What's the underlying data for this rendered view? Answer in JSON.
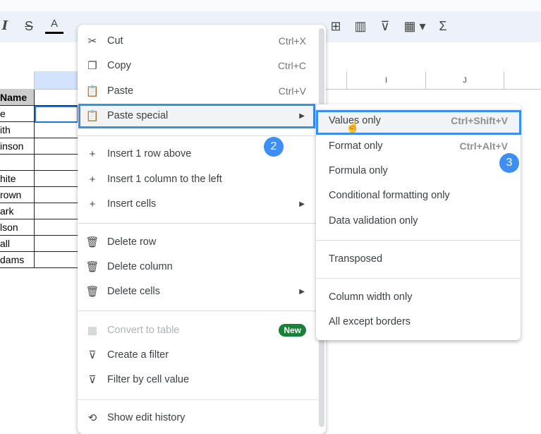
{
  "toolbar": {
    "icons": [
      "italic-icon",
      "strikethrough-icon",
      "text-color-icon",
      "insert-comment-icon",
      "insert-chart-icon",
      "filter-icon",
      "table-icon",
      "functions-icon"
    ],
    "italic": "I",
    "strike": "S",
    "textcolor": "A",
    "comment": "⊞",
    "chart": "▥",
    "filter": "⊽",
    "table": "▦ ▾",
    "sum": "Σ"
  },
  "columns": {
    "i": "I",
    "j": "J"
  },
  "sheet": {
    "header": "Name",
    "rows": [
      "e",
      "ith",
      "inson",
      "",
      "hite",
      "rown",
      "ark",
      "lson",
      "all",
      "dams"
    ]
  },
  "context_menu": {
    "items": [
      {
        "label": "Cut",
        "shortcut": "Ctrl+X",
        "icon": "✂"
      },
      {
        "label": "Copy",
        "shortcut": "Ctrl+C",
        "icon": "❐"
      },
      {
        "label": "Paste",
        "shortcut": "Ctrl+V",
        "icon": "📋"
      },
      {
        "label": "Paste special",
        "icon": "📋",
        "arrow": "▶"
      },
      {
        "label": "Insert 1 row above",
        "icon": "+"
      },
      {
        "label": "Insert 1 column to the left",
        "icon": "+"
      },
      {
        "label": "Insert cells",
        "icon": "+",
        "arrow": "▶"
      },
      {
        "label": "Delete row",
        "icon": "🗑"
      },
      {
        "label": "Delete column",
        "icon": "🗑"
      },
      {
        "label": "Delete cells",
        "icon": "🗑",
        "arrow": "▶"
      },
      {
        "label": "Convert to table",
        "icon": "▦",
        "badge": "New"
      },
      {
        "label": "Create a filter",
        "icon": "⊽"
      },
      {
        "label": "Filter by cell value",
        "icon": "⊽"
      },
      {
        "label": "Show edit history",
        "icon": "⟲"
      }
    ]
  },
  "submenu": {
    "items": [
      {
        "label": "Values only",
        "shortcut": "Ctrl+Shift+V"
      },
      {
        "label": "Format only",
        "shortcut": "Ctrl+Alt+V"
      },
      {
        "label": "Formula only"
      },
      {
        "label": "Conditional formatting only"
      },
      {
        "label": "Data validation only"
      },
      {
        "label": "Transposed"
      },
      {
        "label": "Column width only"
      },
      {
        "label": "All except borders"
      }
    ]
  },
  "steps": {
    "two": "2",
    "three": "3"
  },
  "colors": {
    "accent": "#3a8ef0",
    "badge_green": "#188038",
    "badge_blue": "#3d8ff5"
  }
}
